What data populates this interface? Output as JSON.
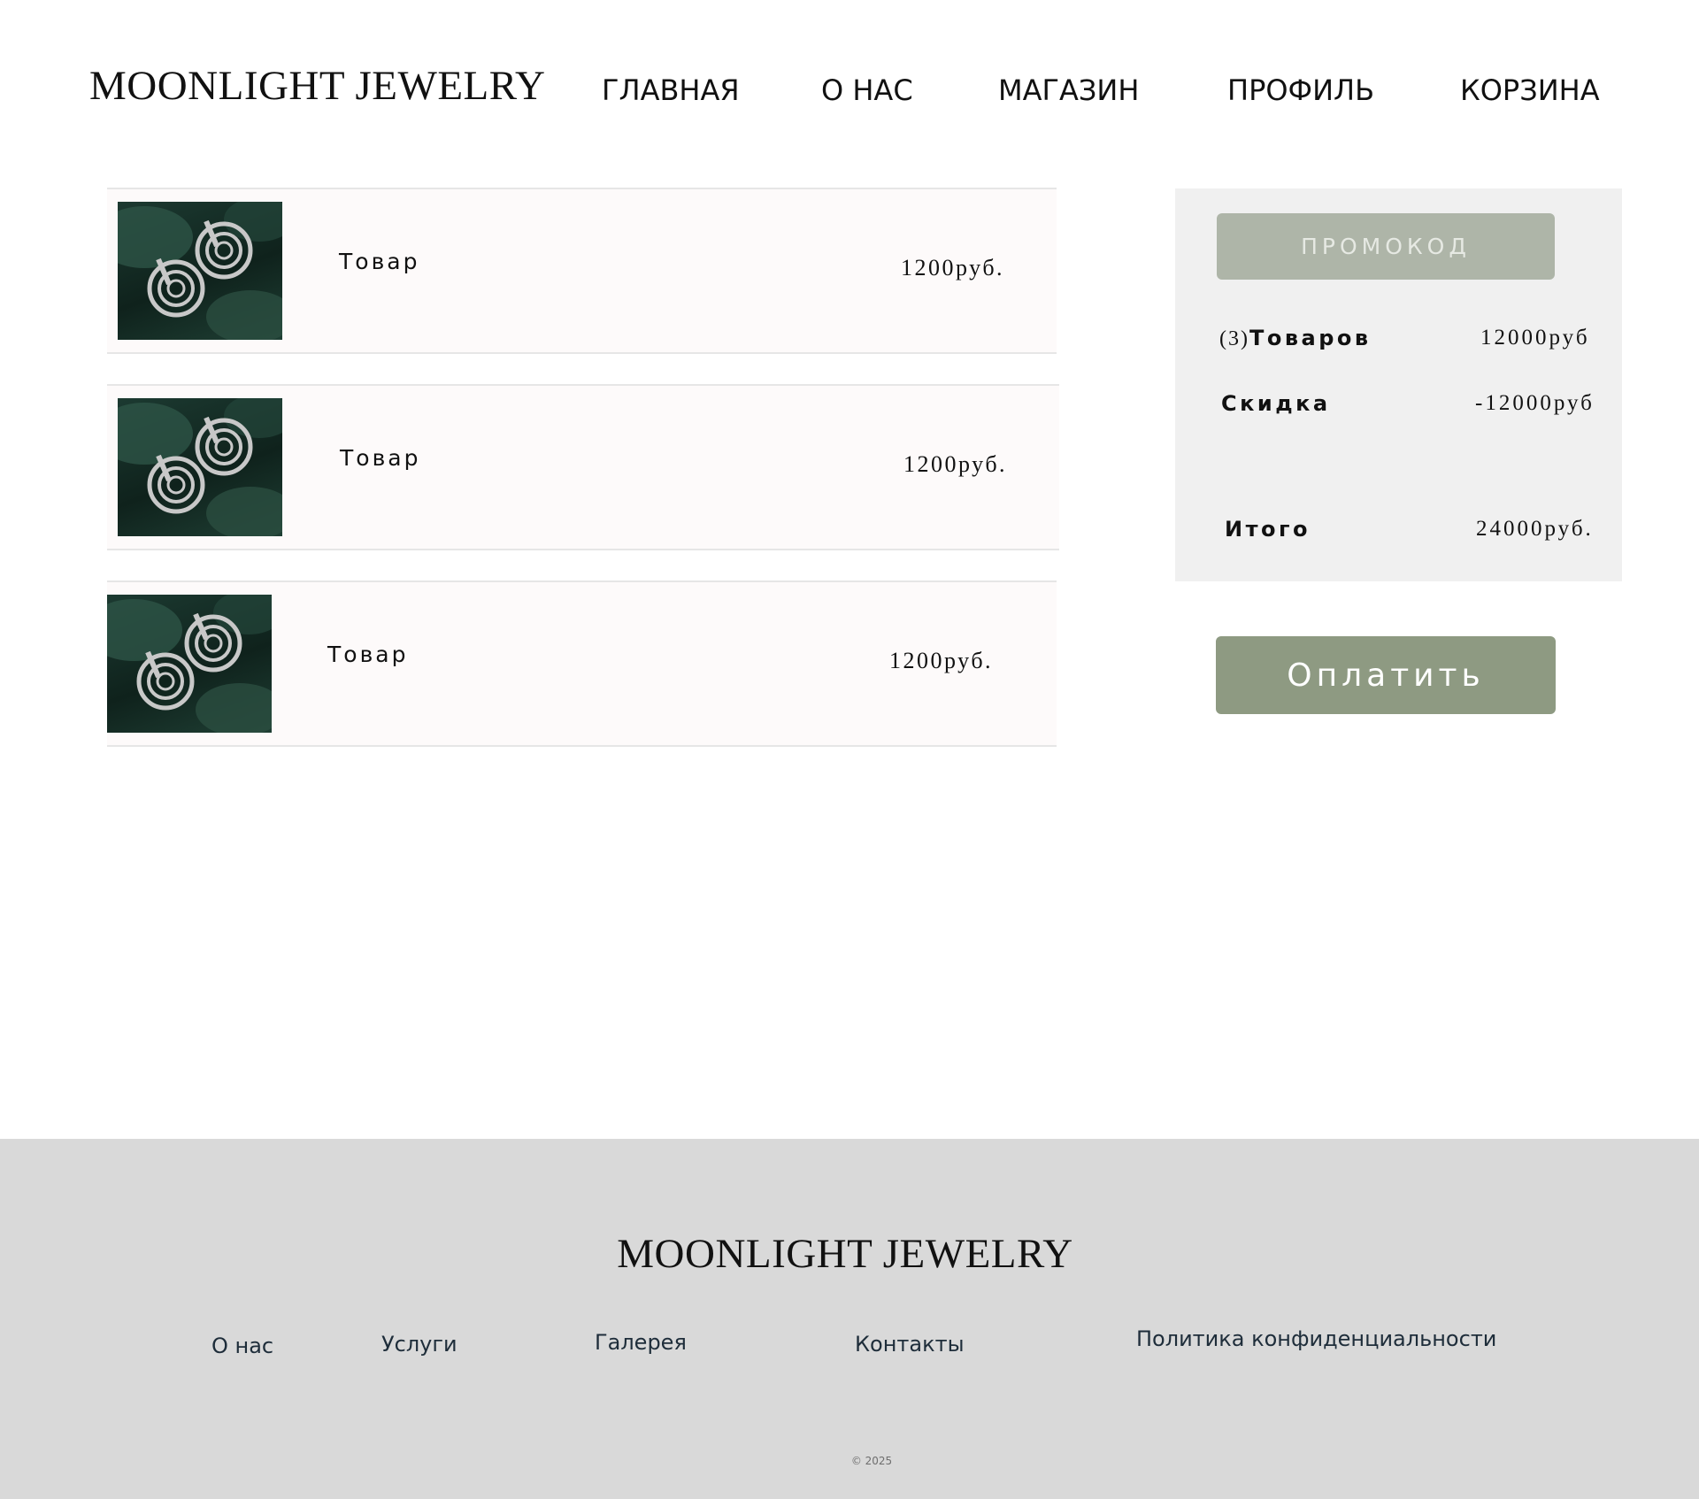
{
  "header": {
    "logo": "MOONLIGHT JEWELRY",
    "nav": [
      "ГЛАВНАЯ",
      "О НАС",
      "МАГАЗИН",
      "ПРОФИЛЬ",
      "КОРЗИНА"
    ]
  },
  "cart": {
    "items": [
      {
        "name": "Товар",
        "price": "1200руб.",
        "image": "earrings-photo"
      },
      {
        "name": "Товар",
        "price": "1200руб.",
        "image": "earrings-photo"
      },
      {
        "name": "Товар",
        "price": "1200руб.",
        "image": "earrings-photo"
      }
    ]
  },
  "summary": {
    "promo_label": "ПРОМОКОД",
    "items_count": "(3)",
    "items_label": "Товаров",
    "items_value": "12000руб",
    "discount_label": "Скидка",
    "discount_value": "-12000руб",
    "total_label": "Итого",
    "total_value": "24000руб.",
    "pay_label": "Оплатить"
  },
  "footer": {
    "logo": "MOONLIGHT JEWELRY",
    "links": [
      "О нас",
      "Услуги",
      "Галерея",
      "Контакты",
      "Политика конфиденциальности"
    ],
    "copyright": "© 2025"
  },
  "colors": {
    "accent": "#8e9a82",
    "promo_button": "#aeb5a8",
    "summary_bg": "#f0f0f0",
    "row_bg": "#fdfafa",
    "footer_bg": "#d9d9d9"
  }
}
